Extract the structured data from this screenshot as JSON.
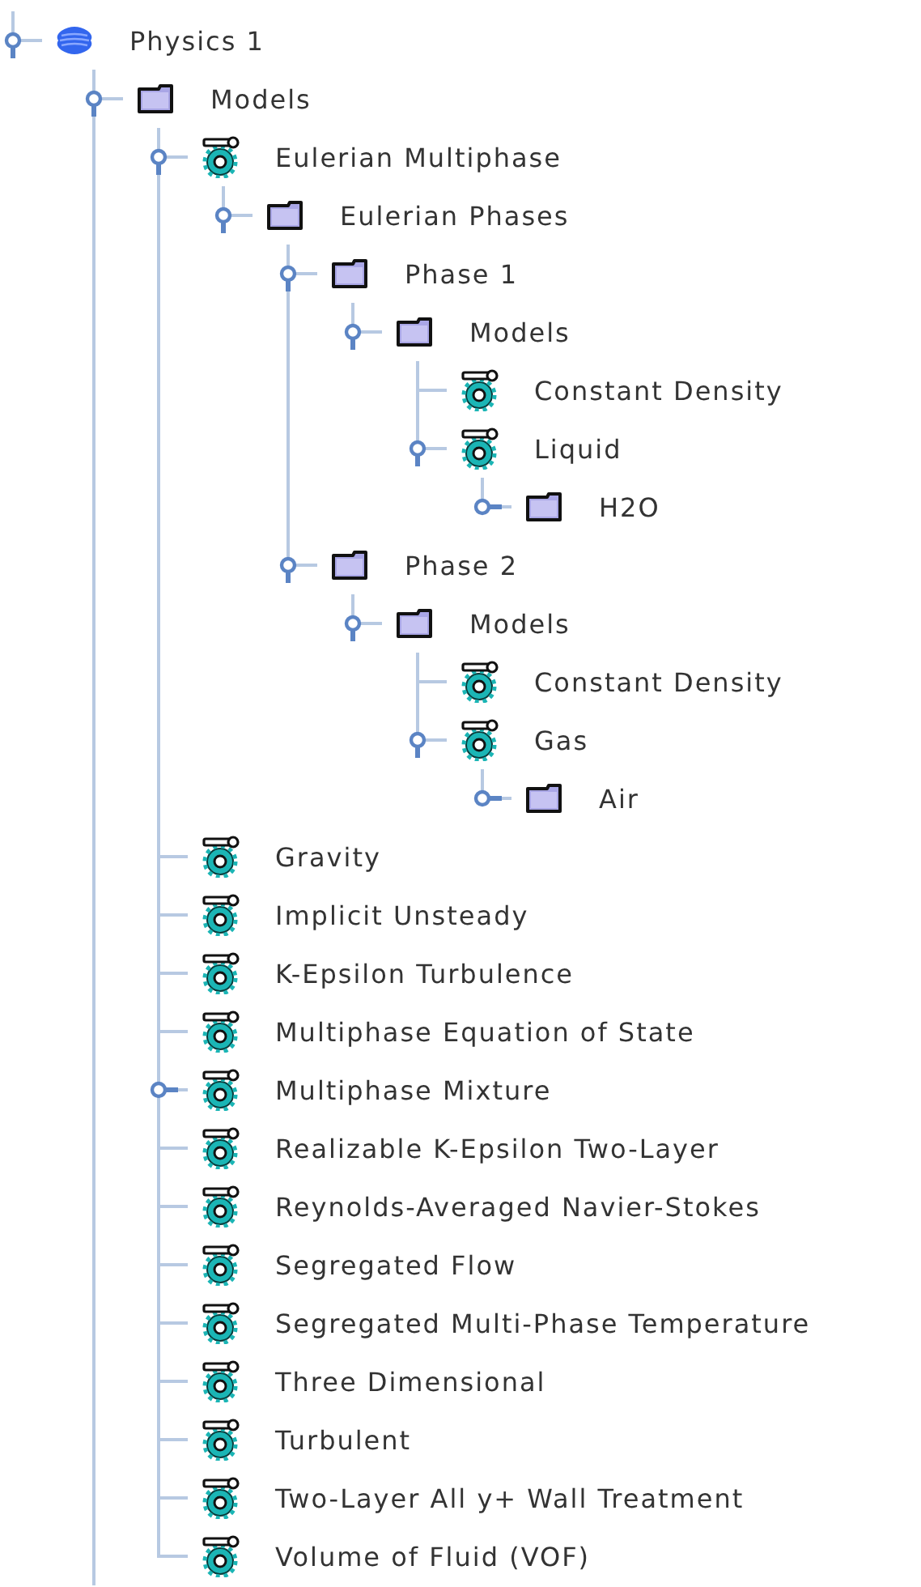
{
  "tree": [
    {
      "label": "Physics 1",
      "kind": "physics",
      "expanded": true,
      "children": [
        {
          "label": "Models",
          "kind": "folder",
          "expanded": true,
          "children": [
            {
              "label": "Eulerian Multiphase",
              "kind": "model",
              "expanded": true,
              "children": [
                {
                  "label": "Eulerian Phases",
                  "kind": "folder",
                  "expanded": true,
                  "children": [
                    {
                      "label": "Phase 1",
                      "kind": "folder",
                      "expanded": true,
                      "children": [
                        {
                          "label": "Models",
                          "kind": "folder",
                          "expanded": true,
                          "children": [
                            {
                              "label": "Constant Density",
                              "kind": "model"
                            },
                            {
                              "label": "Liquid",
                              "kind": "model",
                              "expanded": true,
                              "children": [
                                {
                                  "label": "H2O",
                                  "kind": "folder",
                                  "expanded": false
                                }
                              ]
                            }
                          ]
                        }
                      ]
                    },
                    {
                      "label": "Phase 2",
                      "kind": "folder",
                      "expanded": true,
                      "children": [
                        {
                          "label": "Models",
                          "kind": "folder",
                          "expanded": true,
                          "children": [
                            {
                              "label": "Constant Density",
                              "kind": "model"
                            },
                            {
                              "label": "Gas",
                              "kind": "model",
                              "expanded": true,
                              "children": [
                                {
                                  "label": "Air",
                                  "kind": "folder",
                                  "expanded": false
                                }
                              ]
                            }
                          ]
                        }
                      ]
                    }
                  ]
                }
              ]
            },
            {
              "label": "Gravity",
              "kind": "model"
            },
            {
              "label": "Implicit Unsteady",
              "kind": "model"
            },
            {
              "label": "K-Epsilon Turbulence",
              "kind": "model"
            },
            {
              "label": "Multiphase Equation of State",
              "kind": "model"
            },
            {
              "label": "Multiphase Mixture",
              "kind": "model",
              "expanded": false
            },
            {
              "label": "Realizable K-Epsilon Two-Layer",
              "kind": "model"
            },
            {
              "label": "Reynolds-Averaged Navier-Stokes",
              "kind": "model"
            },
            {
              "label": "Segregated Flow",
              "kind": "model"
            },
            {
              "label": "Segregated Multi-Phase Temperature",
              "kind": "model"
            },
            {
              "label": "Three Dimensional",
              "kind": "model"
            },
            {
              "label": "Turbulent",
              "kind": "model"
            },
            {
              "label": "Two-Layer All y+ Wall Treatment",
              "kind": "model"
            },
            {
              "label": "Volume of Fluid (VOF)",
              "kind": "model"
            }
          ]
        }
      ]
    }
  ]
}
